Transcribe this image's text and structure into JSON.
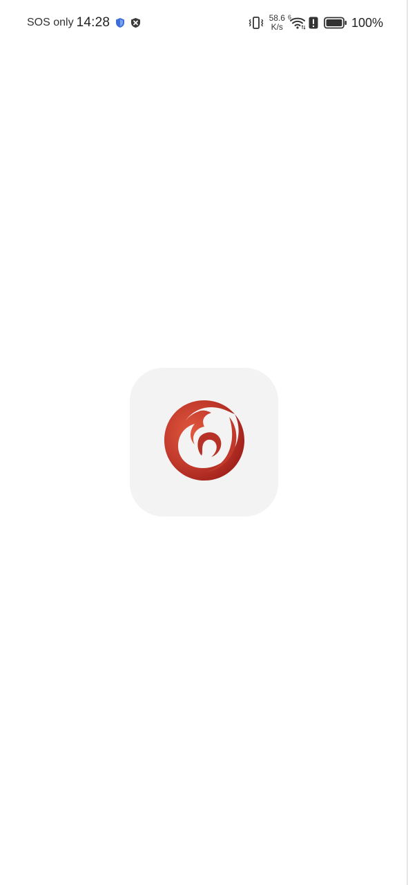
{
  "status_bar": {
    "carrier": "SOS only",
    "time": "14:28",
    "net_speed_value": "58.6",
    "net_speed_unit": "K/s",
    "signal_label": "6",
    "battery_percent": "100%"
  },
  "splash": {
    "logo_icon": "app-logo-icon",
    "logo_colors": {
      "primary": "#c0392b",
      "highlight": "#e2583e",
      "background": "#f4f3f3"
    }
  }
}
